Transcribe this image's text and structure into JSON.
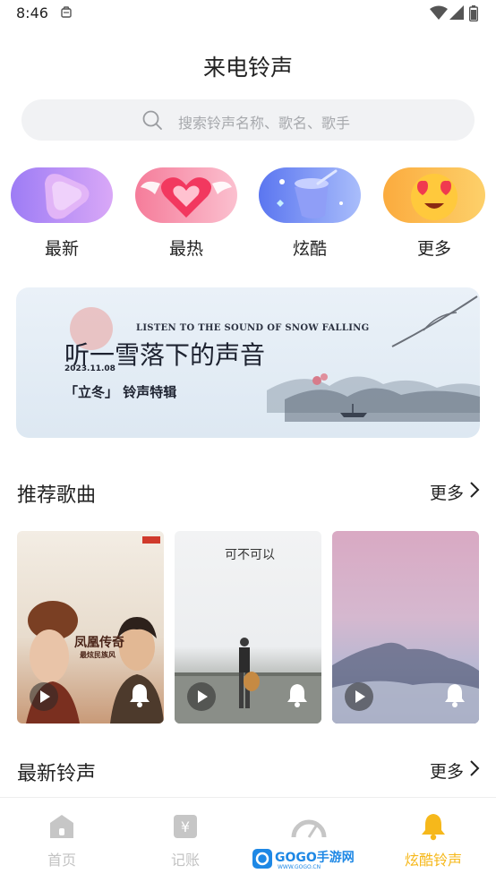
{
  "status_bar": {
    "time": "8:46"
  },
  "page_title": "来电铃声",
  "search": {
    "placeholder": "搜索铃声名称、歌名、歌手"
  },
  "categories": [
    {
      "label": "最新"
    },
    {
      "label": "最热"
    },
    {
      "label": "炫酷"
    },
    {
      "label": "更多"
    }
  ],
  "banner": {
    "english_title": "LISTEN TO THE SOUND OF SNOW FALLING",
    "title": "听一雪落下的声音",
    "date": "2023.11.08",
    "subtitle": "「立冬」 铃声特辑"
  },
  "recommended": {
    "title": "推荐歌曲",
    "more_label": "更多",
    "cards": [
      {
        "cover_text": "凤凰传奇",
        "cover_subtext": "最炫民族风"
      },
      {
        "cover_text": "可不可以",
        "cover_subtext": ""
      },
      {
        "cover_text": "",
        "cover_subtext": ""
      }
    ]
  },
  "latest": {
    "title": "最新铃声",
    "more_label": "更多"
  },
  "tabs": [
    {
      "label": "首页",
      "active": false
    },
    {
      "label": "记账",
      "active": false
    },
    {
      "label": "",
      "active": false
    },
    {
      "label": "炫酷铃声",
      "active": true
    }
  ],
  "watermark": {
    "text": "GOGO手游网",
    "url_text": "WWW.GOGO.CN"
  },
  "colors": {
    "accent": "#f6b81b",
    "inactive_tab": "#c3c3c3",
    "text": "#222222",
    "search_bg": "#f1f2f4"
  }
}
